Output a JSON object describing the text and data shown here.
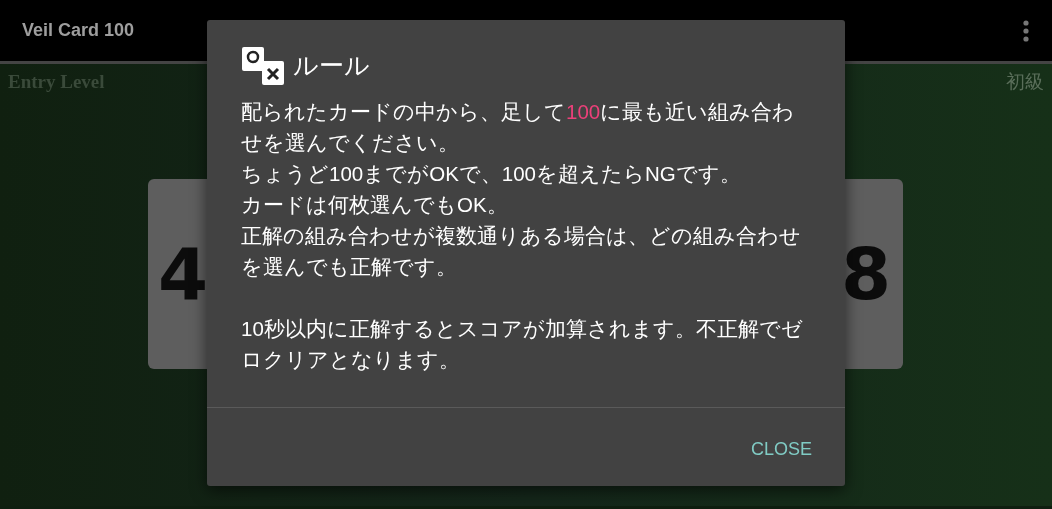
{
  "app_bar": {
    "title": "Veil Card 100"
  },
  "level": {
    "label": "Entry Level",
    "label_ja": "初級"
  },
  "cards": [
    {
      "value": "4"
    },
    {
      "value": "8"
    }
  ],
  "dialog": {
    "title": "ルール",
    "paragraphs": [
      {
        "sentences": [
          {
            "segments": [
              {
                "text": "配られたカードの中から、足して",
                "highlight": false
              },
              {
                "text": "100",
                "highlight": true
              },
              {
                "text": "に最も近い組み合わせを選んでください。",
                "highlight": false
              }
            ]
          },
          {
            "segments": [
              {
                "text": "ちょうど100までがOKで、100を超えたらNGです。",
                "highlight": false
              }
            ]
          },
          {
            "segments": [
              {
                "text": "カードは何枚選んでもOK。",
                "highlight": false
              }
            ]
          },
          {
            "segments": [
              {
                "text": "正解の組み合わせが複数通りある場合は、どの組み合わせを選んでも正解です。",
                "highlight": false
              }
            ]
          }
        ]
      },
      {
        "sentences": [
          {
            "segments": [
              {
                "text": "10秒以内に正解するとスコアが加算されます。不正解でゼロクリアとなります。",
                "highlight": false
              }
            ]
          }
        ]
      }
    ],
    "buttons": [
      "CLOSE"
    ]
  }
}
